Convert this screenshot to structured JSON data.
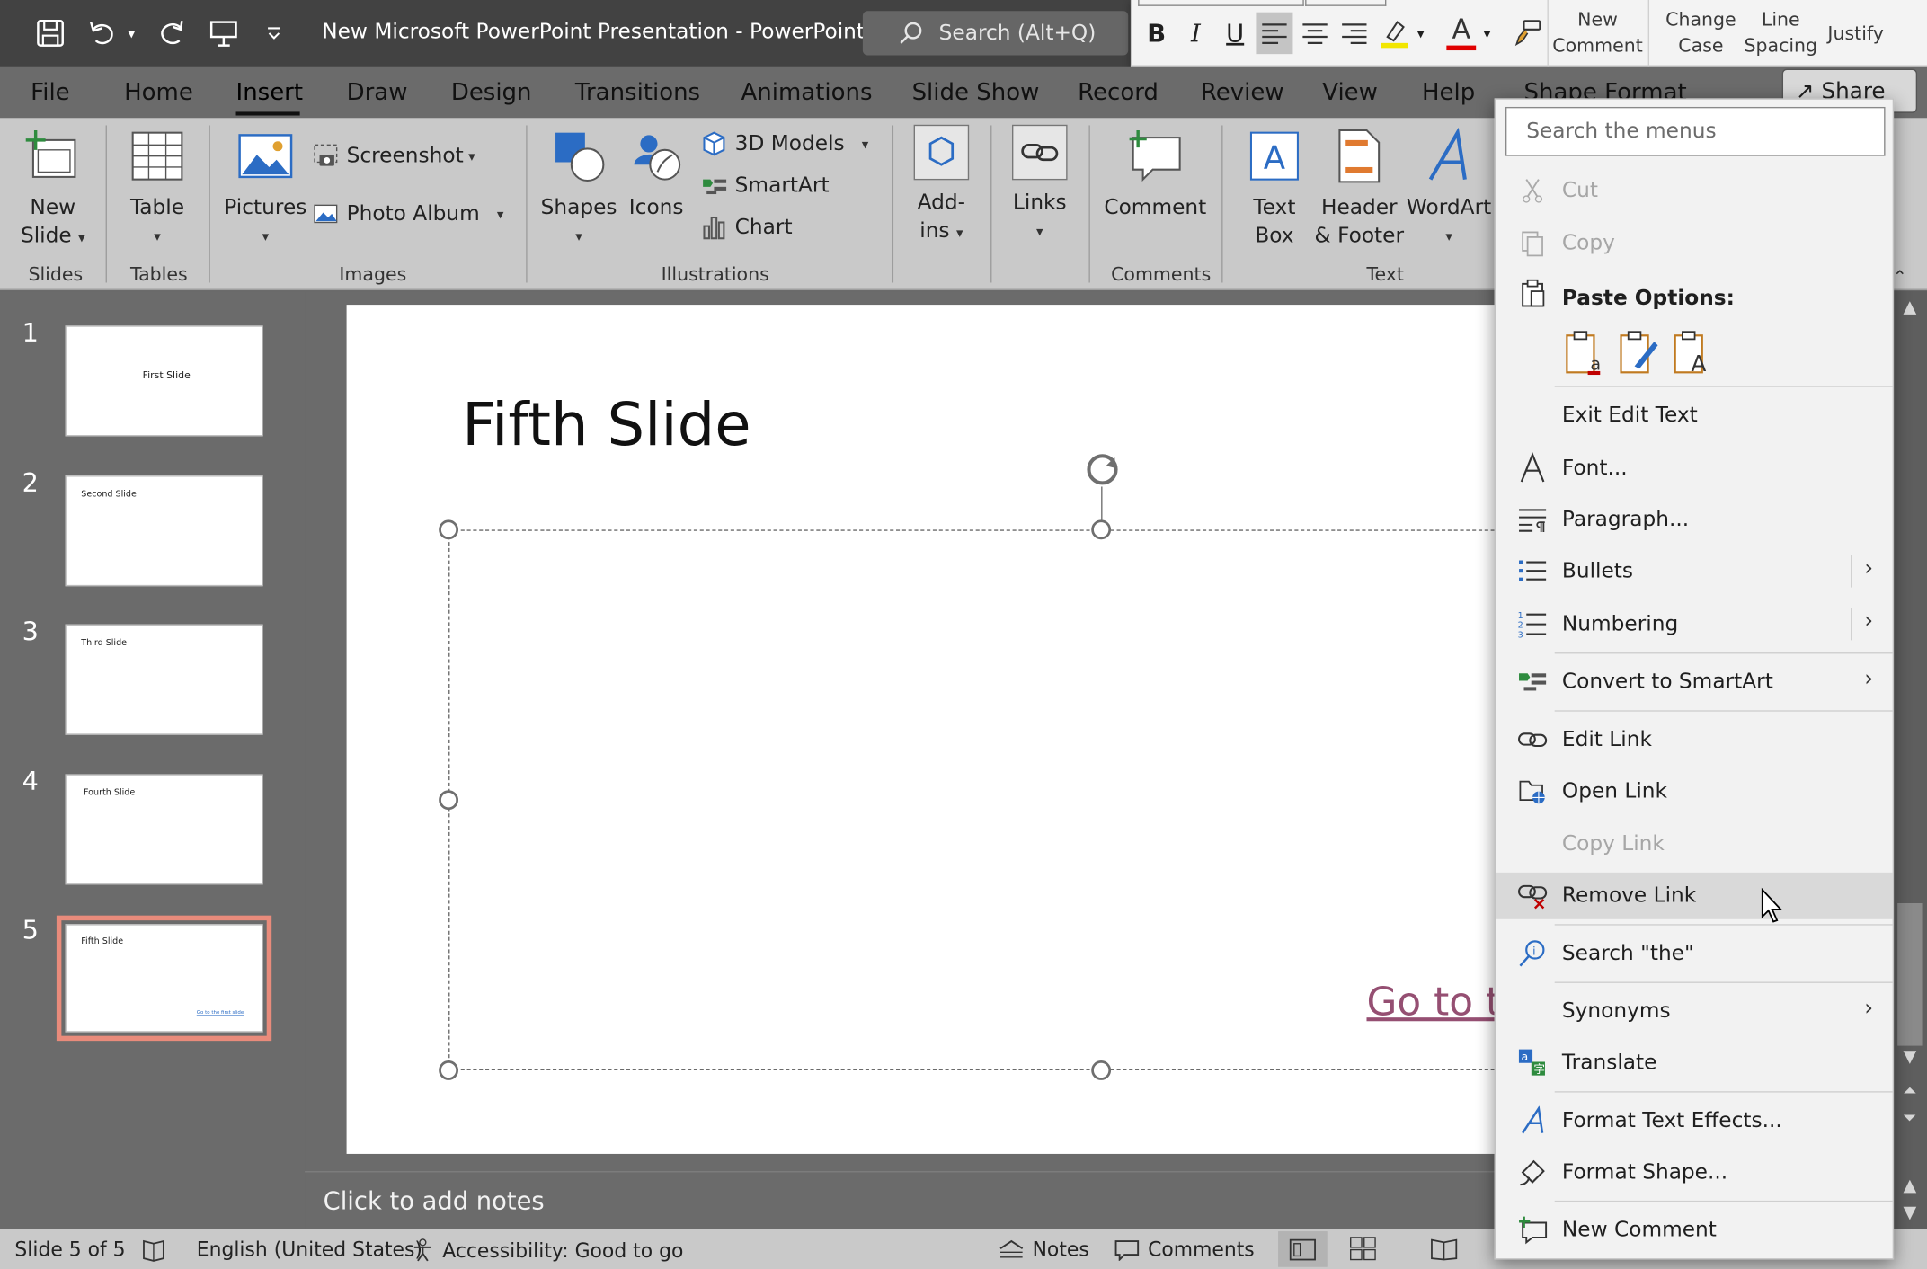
{
  "window": {
    "title": "New Microsoft PowerPoint Presentation  -  PowerPoint",
    "search_placeholder": "Search (Alt+Q)"
  },
  "mini_toolbar": {
    "bold": "B",
    "italic": "I",
    "underline": "U",
    "font_color_glyph": "A",
    "new_comment": [
      "New",
      "Comment"
    ],
    "change_case": [
      "Change",
      "Case"
    ],
    "line_spacing": [
      "Line",
      "Spacing"
    ],
    "justify": "Justify"
  },
  "tabs": [
    "File",
    "Home",
    "Insert",
    "Draw",
    "Design",
    "Transitions",
    "Animations",
    "Slide Show",
    "Record",
    "Review",
    "View",
    "Help",
    "Shape Format"
  ],
  "active_tab": "Insert",
  "share_label": "Share",
  "ribbon": {
    "new_slide": [
      "New",
      "Slide"
    ],
    "table": "Table",
    "pictures": "Pictures",
    "screenshot": "Screenshot",
    "photo_album": "Photo Album",
    "shapes": "Shapes",
    "icons": "Icons",
    "models_3d": "3D Models",
    "smartart": "SmartArt",
    "chart": "Chart",
    "addins": [
      "Add-",
      "ins"
    ],
    "links": "Links",
    "comment": "Comment",
    "text_box": [
      "Text",
      "Box"
    ],
    "header_footer": [
      "Header",
      "& Footer"
    ],
    "wordart": "WordArt",
    "groups": {
      "slides": "Slides",
      "tables": "Tables",
      "images": "Images",
      "illustrations": "Illustrations",
      "comments": "Comments",
      "text": "Text"
    }
  },
  "slides": [
    {
      "num": "1",
      "title": "First Slide"
    },
    {
      "num": "2",
      "title": "Second Slide"
    },
    {
      "num": "3",
      "title": "Third Slide"
    },
    {
      "num": "4",
      "title": "Fourth Slide"
    },
    {
      "num": "5",
      "title": "Fifth  Slide",
      "link": "Go to the first slide"
    }
  ],
  "current_slide": {
    "title": "Fifth  Slide",
    "link_text_visible": "Go to t"
  },
  "notes_placeholder": "Click to add notes",
  "status": {
    "slide_counter": "Slide 5 of 5",
    "language": "English (United States)",
    "accessibility": "Accessibility: Good to go",
    "notes": "Notes",
    "comments": "Comments"
  },
  "context_menu": {
    "search_placeholder": "Search the menus",
    "paste_options_label": "Paste Options:",
    "items": {
      "cut": "Cut",
      "copy": "Copy",
      "exit_edit_text": "Exit Edit Text",
      "font": "Font...",
      "paragraph": "Paragraph...",
      "bullets": "Bullets",
      "numbering": "Numbering",
      "convert_smartart": "Convert to SmartArt",
      "edit_link": "Edit Link",
      "open_link": "Open Link",
      "copy_link": "Copy Link",
      "remove_link": "Remove Link",
      "search_the": "Search \"the\"",
      "synonyms": "Synonyms",
      "translate": "Translate",
      "format_text_effects": "Format Text Effects...",
      "format_shape": "Format Shape...",
      "new_comment": "New Comment"
    }
  },
  "colors": {
    "titlebar": "#424242",
    "ribbon": "#c9c9c9",
    "workspace": "#6b6b6b",
    "selected_slide_border": "#e98b7b",
    "hyperlink": "#954f72",
    "menu_bg": "#f2f2f2",
    "accent_red": "#c00000",
    "accent_green": "#2e8b3e",
    "accent_blue": "#2b6cc4"
  }
}
